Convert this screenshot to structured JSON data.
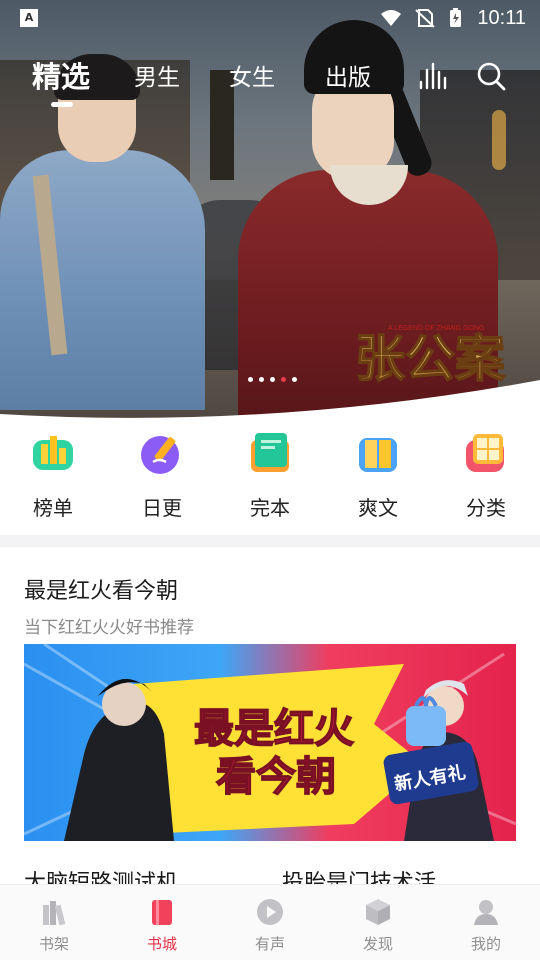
{
  "status_bar": {
    "time": "10:11",
    "app_badge": "A"
  },
  "top_nav": {
    "tabs": [
      {
        "label": "精选",
        "active": true
      },
      {
        "label": "男生",
        "active": false
      },
      {
        "label": "女生",
        "active": false
      },
      {
        "label": "出版",
        "active": false
      }
    ],
    "icons": [
      "ranking-bars-icon",
      "search-icon"
    ]
  },
  "banner": {
    "logo_text": "张公案",
    "logo_subtext": "A LEGEND OF ZHANG GONG",
    "dots": {
      "count": 5,
      "active_index": 3
    }
  },
  "categories": [
    {
      "label": "榜单",
      "icon": "ranking-icon",
      "color": "#f5c232"
    },
    {
      "label": "日更",
      "icon": "daily-update-icon",
      "color": "#8b5cf6"
    },
    {
      "label": "完本",
      "icon": "finished-book-icon",
      "color": "#22c08e"
    },
    {
      "label": "爽文",
      "icon": "open-book-icon",
      "color": "#4aa3f5"
    },
    {
      "label": "分类",
      "icon": "category-grid-icon",
      "color": "#f2546a"
    }
  ],
  "section": {
    "title": "最是红火看今朝",
    "subtitle": "当下红红火火好书推荐",
    "promo": {
      "headline_line1": "最是红火",
      "headline_line2": "看今朝",
      "gift_text": "新人有礼"
    },
    "books": [
      {
        "title": "大脑短路测试机"
      },
      {
        "title": "投胎是门技术活"
      }
    ]
  },
  "bottom_nav": [
    {
      "label": "书架",
      "icon": "bookshelf-icon",
      "active": false
    },
    {
      "label": "书城",
      "icon": "bookstore-icon",
      "active": true
    },
    {
      "label": "有声",
      "icon": "audio-play-icon",
      "active": false
    },
    {
      "label": "发现",
      "icon": "discover-cube-icon",
      "active": false
    },
    {
      "label": "我的",
      "icon": "profile-icon",
      "active": false
    }
  ],
  "colors": {
    "accent": "#e8344a",
    "inactive": "#8f8f8f"
  }
}
